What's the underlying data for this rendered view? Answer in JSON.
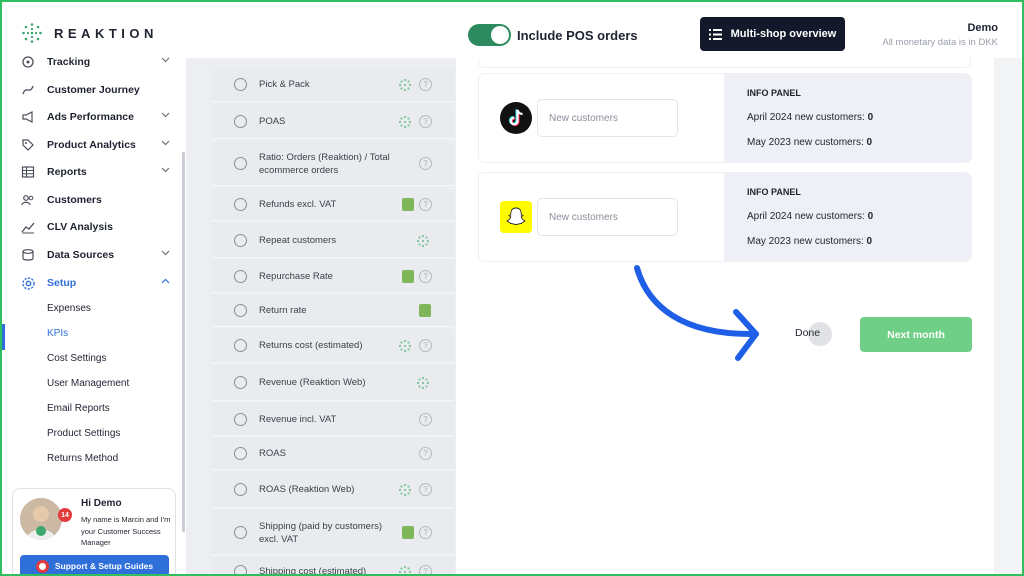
{
  "app": {
    "brand": "REAKTION"
  },
  "header": {
    "toggle_label": "Include POS orders",
    "toggle_on": true,
    "multishop_label": "Multi-shop overview",
    "user_name": "Demo",
    "user_note": "All monetary data is in DKK"
  },
  "sidebar": {
    "items": [
      {
        "label": "Tracking",
        "icon": "tracking-icon",
        "has_chevron": true
      },
      {
        "label": "Customer Journey",
        "icon": "journey-icon",
        "has_chevron": false
      },
      {
        "label": "Ads Performance",
        "icon": "megaphone-icon",
        "has_chevron": true
      },
      {
        "label": "Product Analytics",
        "icon": "tag-icon",
        "has_chevron": true
      },
      {
        "label": "Reports",
        "icon": "table-icon",
        "has_chevron": true
      },
      {
        "label": "Customers",
        "icon": "users-icon",
        "has_chevron": false
      },
      {
        "label": "CLV Analysis",
        "icon": "chart-icon",
        "has_chevron": false
      },
      {
        "label": "Data Sources",
        "icon": "database-icon",
        "has_chevron": true
      },
      {
        "label": "Setup",
        "icon": "gear-icon",
        "has_chevron": true,
        "active": true
      }
    ],
    "sub_items": [
      {
        "label": "Expenses"
      },
      {
        "label": "KPIs",
        "active": true
      },
      {
        "label": "Cost Settings"
      },
      {
        "label": "User Management"
      },
      {
        "label": "Email Reports"
      },
      {
        "label": "Product Settings"
      },
      {
        "label": "Returns Method"
      }
    ],
    "promo": {
      "title": "Hi Demo",
      "text": "My name is Marcin and I'm your Customer Success Manager",
      "badge": "14",
      "button": "Support & Setup Guides"
    }
  },
  "kpis": [
    {
      "label": "Pick & Pack",
      "reaktion": true,
      "shopify": false,
      "help": true
    },
    {
      "label": "POAS",
      "reaktion": true,
      "shopify": false,
      "help": true
    },
    {
      "label": "Ratio: Orders (Reaktion) / Total ecommerce orders",
      "reaktion": false,
      "shopify": false,
      "help": true
    },
    {
      "label": "Refunds excl. VAT",
      "reaktion": false,
      "shopify": true,
      "help": true
    },
    {
      "label": "Repeat customers",
      "reaktion": true,
      "shopify": false,
      "help": false
    },
    {
      "label": "Repurchase Rate",
      "reaktion": false,
      "shopify": true,
      "help": true
    },
    {
      "label": "Return rate",
      "reaktion": false,
      "shopify": true,
      "help": false
    },
    {
      "label": "Returns cost (estimated)",
      "reaktion": true,
      "shopify": false,
      "help": true
    },
    {
      "label": "Revenue (Reaktion Web)",
      "reaktion": true,
      "shopify": false,
      "help": false
    },
    {
      "label": "Revenue incl. VAT",
      "reaktion": false,
      "shopify": false,
      "help": true
    },
    {
      "label": "ROAS",
      "reaktion": false,
      "shopify": false,
      "help": true
    },
    {
      "label": "ROAS (Reaktion Web)",
      "reaktion": true,
      "shopify": false,
      "help": true
    },
    {
      "label": "Shipping (paid by customers) excl. VAT",
      "reaktion": false,
      "shopify": true,
      "help": true
    },
    {
      "label": "Shipping cost (estimated)",
      "reaktion": true,
      "shopify": false,
      "help": true
    }
  ],
  "channels": [
    {
      "brand": "tiktok-icon",
      "placeholder": "New customers",
      "info_title": "INFO PANEL",
      "line1_label": "April 2024 new customers:",
      "line1_value": "0",
      "line2_label": "May 2023 new customers:",
      "line2_value": "0"
    },
    {
      "brand": "snapchat-icon",
      "placeholder": "New customers",
      "info_title": "INFO PANEL",
      "line1_label": "April 2024 new customers:",
      "line1_value": "0",
      "line2_label": "May 2023 new customers:",
      "line2_value": "0"
    }
  ],
  "actions": {
    "done_label": "Done",
    "next_label": "Next month"
  },
  "colors": {
    "accent": "#2f6fd9",
    "success": "#6fcf86",
    "toggle": "#2d8a5f",
    "dark": "#14182b"
  }
}
